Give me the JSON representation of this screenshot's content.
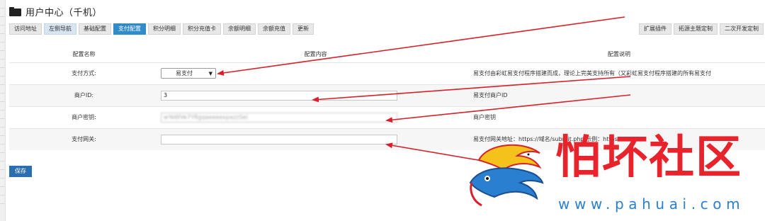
{
  "header": {
    "title": "用户中心（千机）"
  },
  "tabs": [
    {
      "label": "访问地址",
      "style": "normal"
    },
    {
      "label": "左侧导航",
      "style": "light"
    },
    {
      "label": "基础配置",
      "style": "normal"
    },
    {
      "label": "支付配置",
      "style": "active"
    },
    {
      "label": "积分明细",
      "style": "normal"
    },
    {
      "label": "积分充值卡",
      "style": "normal"
    },
    {
      "label": "余额明细",
      "style": "normal"
    },
    {
      "label": "余额充值",
      "style": "normal"
    },
    {
      "label": "更新",
      "style": "normal"
    }
  ],
  "tabs_right": [
    {
      "label": "扩展插件"
    },
    {
      "label": "拓源主题定制"
    },
    {
      "label": "二次开发定制"
    }
  ],
  "table": {
    "headers": [
      "配置名称",
      "配置内容",
      "配置说明"
    ],
    "rows": [
      {
        "name": "支付方式:",
        "value": "易支付",
        "note": "易支付由彩虹易支付程序搭建而成，理论上完美支持所有（又彩虹易支付程序搭建的所有易支付"
      },
      {
        "name": "商户ID:",
        "value": "3",
        "note": "易支付商户ID"
      },
      {
        "name": "商户密钥:",
        "value": "wYeWVe7YRgqaeeeexpazzSe(",
        "note": "商户密钥"
      },
      {
        "name": "支付网关:",
        "value": "",
        "note": "易支付网关地址：https://域名/submit.php 示例：https://xx.com/"
      }
    ]
  },
  "save_label": "保存",
  "watermark": {
    "title": "怕坏社区",
    "url": "www.pahuai.com"
  },
  "colors": {
    "active_tab": "#2f8cc8",
    "save_button": "#2a6db0",
    "arrow": "#d8202a",
    "watermark_red": "#e8232c",
    "watermark_blue": "#2a7fd1"
  }
}
